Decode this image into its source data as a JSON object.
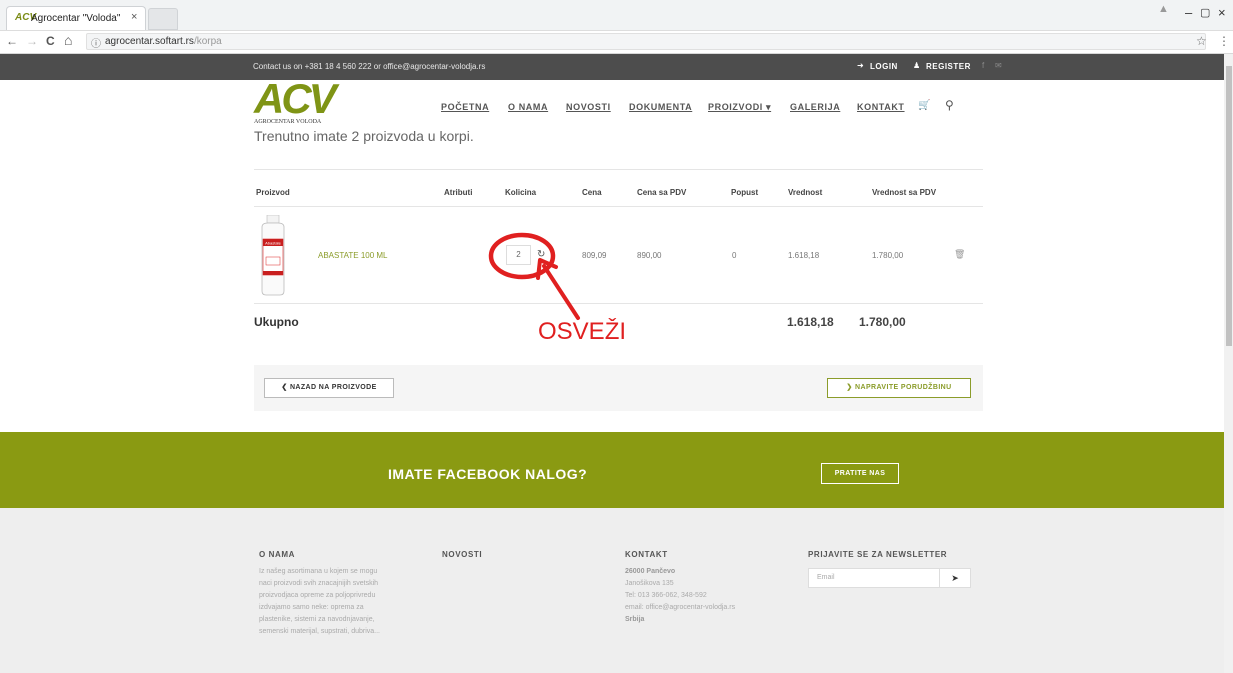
{
  "browser": {
    "tab_title": "Agrocentar \"Voloda\"",
    "tab_close": "×",
    "url_host": "agrocentar.softart.rs",
    "url_path": "/korpa",
    "back": "←",
    "forward": "→",
    "reload": "C",
    "home": "⌂",
    "info": "ⓘ",
    "star": "☆",
    "menu": "⋮",
    "minimize": "–",
    "restore": "▢",
    "close": "×",
    "profile": "▲"
  },
  "topbar": {
    "contact": "Contact us on +381 18 4 560 222 or office@agrocentar-volodja.rs",
    "login": "LOGIN",
    "register": "REGISTER",
    "login_icon": "➜",
    "register_icon": "♟",
    "facebook_icon": "f",
    "mail_icon": "✉"
  },
  "header": {
    "logo": "ACV",
    "logo_sub": "AGROCENTAR VOLODA",
    "nav": [
      "POČETNA",
      "O NAMA",
      "NOVOSTI",
      "DOKUMENTA",
      "PROIZVODI ▾",
      "GALERIJA",
      "KONTAKT"
    ],
    "cart_icon": "🛒",
    "search_icon": "⚲"
  },
  "cart": {
    "message": "Trenutno imate 2 proizvoda u korpi.",
    "headers": [
      "Proizvod",
      "Atributi",
      "Kolicina",
      "Cena",
      "Cena sa PDV",
      "Popust",
      "Vrednost",
      "Vrednost sa PDV"
    ],
    "item": {
      "name": "ABASTATE 100 ML",
      "bottle_label": "Abastate",
      "quantity": "2",
      "price": "809,09",
      "price_vat": "890,00",
      "discount": "0",
      "value": "1.618,18",
      "value_vat": "1.780,00"
    },
    "refresh_icon": "↻",
    "trash_icon": "🗑",
    "total_label": "Ukupno",
    "total_value": "1.618,18",
    "total_value_vat": "1.780,00",
    "annotation": "OSVEŽI",
    "back_button": "❮  NAZAD NA PROIZVODE",
    "order_button": "❯  NAPRAVITE PORUDŽBINU"
  },
  "facebook": {
    "title": "IMATE FACEBOOK NALOG?",
    "button": "PRATITE NAS"
  },
  "footer": {
    "about_title": "O NAMA",
    "about_lines": [
      "Iz našeg asortimana u kojem se mogu",
      "naci proizvodi svih znacajnijih svetskih",
      "proizvodjaca opreme za poljoprivredu",
      "izdvajamo samo neke: oprema za",
      "plastenike, sistemi za navodnjavanje,",
      "semenski materijal, supstrati, dubriva..."
    ],
    "news_title": "NOVOSTI",
    "contact_title": "KONTAKT",
    "contact_city": "26000 Pančevo",
    "contact_street": "Janošikova 135",
    "contact_phone": "Tel: 013 366-062, 348-592",
    "contact_email": "email: office@agrocentar-volodja.rs",
    "contact_country": "Srbija",
    "newsletter_title": "PRIJAVITE SE ZA NEWSLETTER",
    "newsletter_placeholder": "Email",
    "newsletter_icon": "➤"
  },
  "colors": {
    "brand_green": "#8a9a12",
    "annotation_red": "#e02020",
    "topbar": "#4d4d4d"
  }
}
